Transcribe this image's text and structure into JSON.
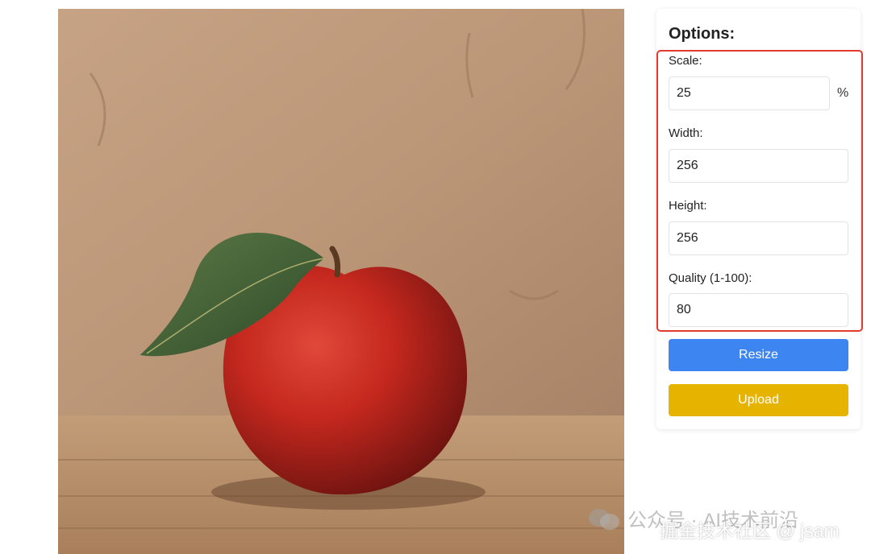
{
  "photo": {
    "subject": "red apple with leaf on wooden table"
  },
  "options": {
    "title": "Options:",
    "scale": {
      "label": "Scale:",
      "value": "25",
      "suffix": "%"
    },
    "width": {
      "label": "Width:",
      "value": "256"
    },
    "height": {
      "label": "Height:",
      "value": "256"
    },
    "quality": {
      "label": "Quality (1-100):",
      "value": "80"
    },
    "resize_label": "Resize",
    "upload_label": "Upload"
  },
  "watermark": {
    "line1": "公众号 · AI技术前沿",
    "line2": "掘金技术社区 @ jsam"
  },
  "colors": {
    "resize_button": "#3d86f2",
    "upload_button": "#e6b400",
    "highlight_border": "#e23b2e"
  }
}
